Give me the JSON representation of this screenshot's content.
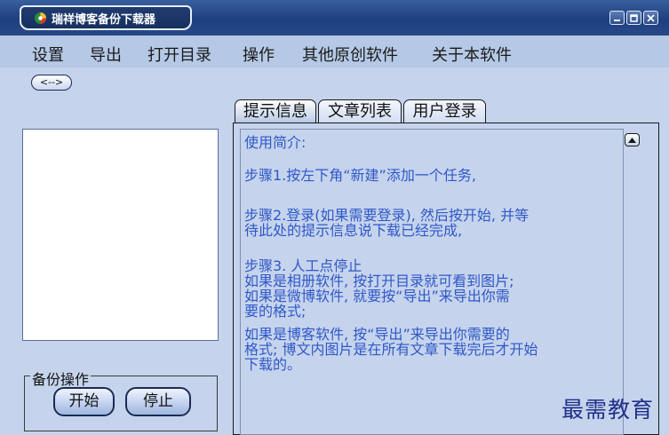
{
  "window": {
    "title": "瑞祥博客备份下载器"
  },
  "menu": {
    "items": [
      "设置",
      "导出",
      "打开目录",
      "操作",
      "其他原创软件",
      "关于本软件"
    ]
  },
  "toolbar": {
    "back_label": "<-->"
  },
  "backup_group": {
    "label": "备份操作",
    "start_label": "开始",
    "stop_label": "停止"
  },
  "tabs": [
    {
      "label": "提示信息",
      "active": true
    },
    {
      "label": "文章列表",
      "active": false
    },
    {
      "label": "用户登录",
      "active": false
    }
  ],
  "info": {
    "lines": [
      "使用简介:",
      "步骤1.按左下角“新建”添加一个任务,",
      "步骤2.登录(如果需要登录), 然后按开始, 并等",
      "待此处的提示信息说下载已经完成,",
      "步骤3. 人工点停止",
      "  如果是相册软件, 按打开目录就可看到图片;",
      "  如果是微博软件, 就要按“导出”来导出你需",
      "要的格式;",
      "  如果是博客软件, 按“导出”来导出你需要的",
      "格式; 博文内图片是在所有文章下载完后才开始",
      "下载的。"
    ]
  },
  "watermark": "最需教育",
  "colors": {
    "title_bar": "#1d3f7f",
    "window_bg": "#c5d4ec",
    "info_text": "#3057c8"
  }
}
